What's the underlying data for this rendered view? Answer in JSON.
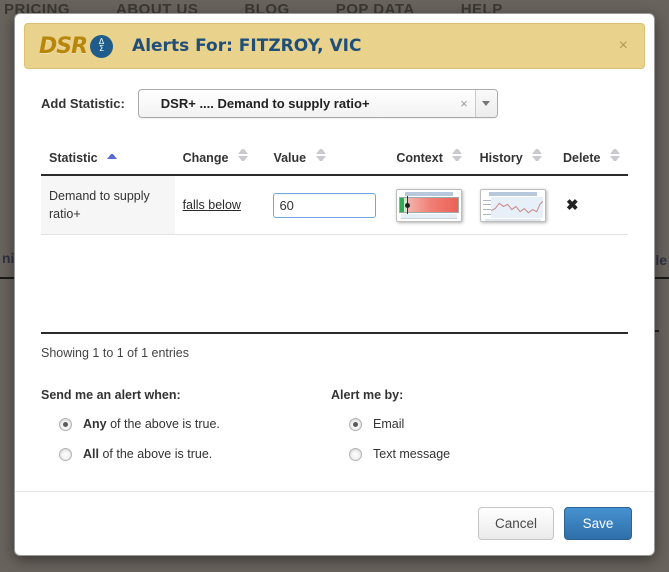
{
  "background": {
    "nav_items": [
      "PRICING",
      "ABOUT US",
      "BLOG",
      "POP DATA",
      "HELP"
    ],
    "left_fragment": "ni",
    "right_fragment": "le"
  },
  "modal": {
    "logo_text": "DSR",
    "logo_badge_top": "Δ",
    "logo_badge_bottom": "Σ",
    "title": "Alerts For: FITZROY, VIC",
    "close_label": "×",
    "add_statistic": {
      "label": "Add Statistic:",
      "selected_value": "DSR+ .... Demand to supply ratio+",
      "clear_label": "×",
      "dropdown_icon": "chevron-down-icon"
    },
    "table": {
      "columns": [
        {
          "label": "Statistic",
          "sorted": "asc"
        },
        {
          "label": "Change",
          "sorted": "none"
        },
        {
          "label": "Value",
          "sorted": "none"
        },
        {
          "label": "Context",
          "sorted": "none"
        },
        {
          "label": "History",
          "sorted": "none"
        },
        {
          "label": "Delete",
          "sorted": "none"
        }
      ],
      "rows": [
        {
          "statistic": "Demand to supply ratio+",
          "change": "falls below",
          "value": "60",
          "context_icon": "gauge-thumbnail",
          "history_icon": "line-chart-thumbnail",
          "delete_icon": "✖"
        }
      ],
      "showing_entries": "Showing 1 to 1 of 1 entries"
    },
    "options": {
      "alert_when": {
        "title": "Send me an alert when:",
        "items": [
          {
            "bold": "Any",
            "rest": " of the above is true.",
            "checked": true
          },
          {
            "bold": "All",
            "rest": " of the above is true.",
            "checked": false
          }
        ]
      },
      "alert_by": {
        "title": "Alert me by:",
        "items": [
          {
            "bold": "",
            "rest": "Email",
            "checked": true
          },
          {
            "bold": "",
            "rest": "Text message",
            "checked": false
          }
        ]
      }
    },
    "footer": {
      "cancel_label": "Cancel",
      "save_label": "Save"
    }
  },
  "colors": {
    "header_bg": "#e8d28c",
    "title_blue": "#1f4e79",
    "logo_gold": "#b8860b",
    "save_blue": "#3276b1",
    "sort_active": "#5b6bd6"
  }
}
